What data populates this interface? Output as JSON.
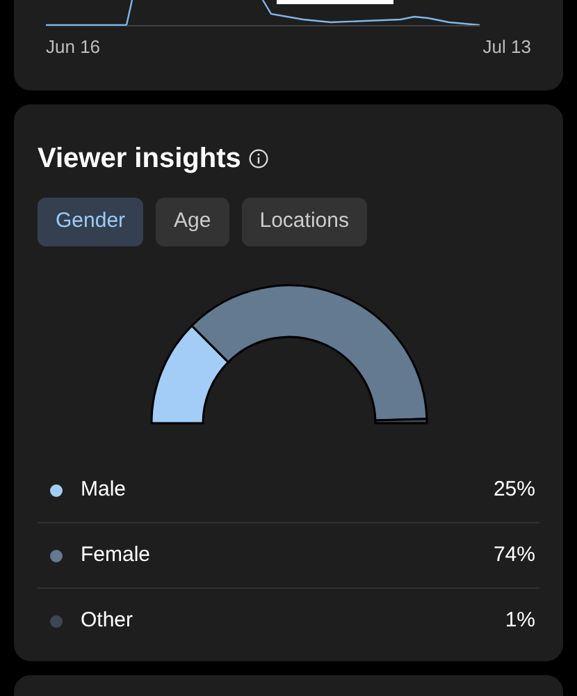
{
  "trend": {
    "start_label": "Jun 16",
    "end_label": "Jul 13"
  },
  "insights": {
    "title": "Viewer insights",
    "tabs": [
      {
        "label": "Gender",
        "selected": true
      },
      {
        "label": "Age",
        "selected": false
      },
      {
        "label": "Locations",
        "selected": false
      }
    ],
    "chart_data": {
      "type": "donut",
      "values": [
        25,
        74,
        1
      ]
    },
    "legend": [
      {
        "name": "Male",
        "value": "25%",
        "color": "#a3cdf7"
      },
      {
        "name": "Female",
        "value": "74%",
        "color": "#637a91"
      },
      {
        "name": "Other",
        "value": "1%",
        "color": "#3c4656"
      }
    ]
  }
}
